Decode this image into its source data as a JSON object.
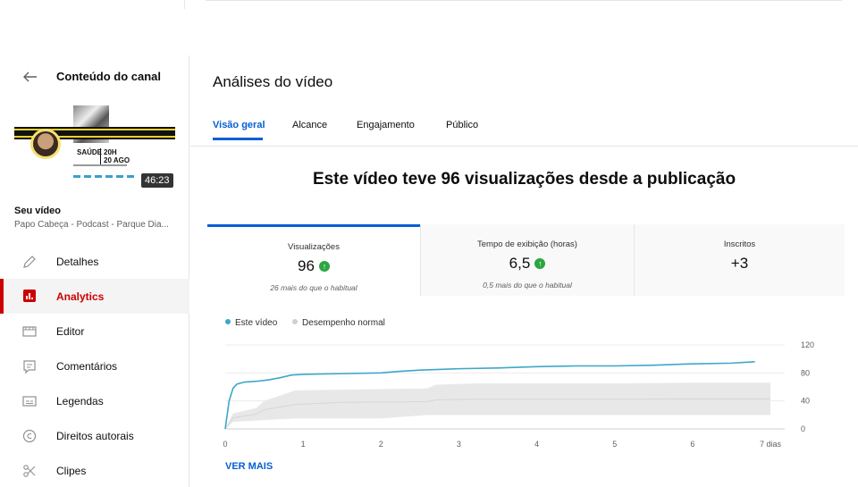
{
  "sidebar": {
    "title": "Conteúdo do canal",
    "video": {
      "duration": "46:23",
      "section_label": "Seu vídeo",
      "name": "Papo Cabeça - Podcast - Parque Dia...",
      "thumbnail_text": "SAÚDE",
      "thumbnail_time": "20H",
      "thumbnail_date": "20 AGO"
    },
    "items": [
      {
        "label": "Detalhes",
        "icon": "pencil-icon"
      },
      {
        "label": "Analytics",
        "icon": "analytics-icon",
        "active": true
      },
      {
        "label": "Editor",
        "icon": "film-editor-icon"
      },
      {
        "label": "Comentários",
        "icon": "comment-icon"
      },
      {
        "label": "Legendas",
        "icon": "subtitles-icon"
      },
      {
        "label": "Direitos autorais",
        "icon": "copyright-icon"
      },
      {
        "label": "Clipes",
        "icon": "scissors-icon"
      }
    ]
  },
  "main": {
    "title": "Análises do vídeo",
    "tabs": [
      {
        "label": "Visão geral",
        "active": true
      },
      {
        "label": "Alcance"
      },
      {
        "label": "Engajamento"
      },
      {
        "label": "Público"
      }
    ],
    "headline": "Este vídeo teve 96 visualizações desde a publicação",
    "metrics": [
      {
        "title": "Visualizações",
        "value": "96",
        "trend": "up",
        "note": "26 mais do que o habitual",
        "active": true
      },
      {
        "title": "Tempo de exibição (horas)",
        "value": "6,5",
        "trend": "up",
        "note": "0,5 mais do que o habitual"
      },
      {
        "title": "Inscritos",
        "value": "+3"
      }
    ],
    "legend": {
      "this_video": "Este vídeo",
      "normal": "Desempenho normal"
    },
    "more_link": "VER MAIS"
  },
  "colors": {
    "accent": "#065fd4",
    "active_nav": "#cc0000",
    "line": "#3ea6c9",
    "band": "#e6e6e6",
    "trend_up": "#2ba640"
  },
  "chart_data": {
    "type": "line",
    "x_ticks": [
      "0",
      "1",
      "2",
      "3",
      "4",
      "5",
      "6",
      "7 dias"
    ],
    "y_ticks": [
      "0",
      "40",
      "80",
      "120"
    ],
    "ylim": [
      0,
      120
    ],
    "xlim": [
      0,
      7
    ],
    "series": [
      {
        "name": "Este vídeo",
        "points": [
          [
            0,
            0
          ],
          [
            0.05,
            40
          ],
          [
            0.1,
            58
          ],
          [
            0.15,
            64
          ],
          [
            0.25,
            67
          ],
          [
            0.4,
            68
          ],
          [
            0.55,
            70
          ],
          [
            0.7,
            73
          ],
          [
            0.85,
            77
          ],
          [
            1.0,
            78
          ],
          [
            1.5,
            79
          ],
          [
            2.0,
            80
          ],
          [
            2.2,
            82
          ],
          [
            2.5,
            84
          ],
          [
            3.0,
            86
          ],
          [
            3.5,
            87
          ],
          [
            4.0,
            89
          ],
          [
            4.5,
            90
          ],
          [
            5.0,
            90
          ],
          [
            5.5,
            91
          ],
          [
            6.0,
            93
          ],
          [
            6.5,
            94
          ],
          [
            6.8,
            96
          ]
        ]
      }
    ],
    "band": {
      "name": "Desempenho normal",
      "lower": [
        [
          0,
          0
        ],
        [
          0.1,
          10
        ],
        [
          0.4,
          12
        ],
        [
          0.9,
          15
        ],
        [
          2.0,
          15
        ],
        [
          2.6,
          20
        ],
        [
          3.2,
          20
        ],
        [
          4.0,
          20
        ],
        [
          5.0,
          20
        ],
        [
          6.0,
          20
        ],
        [
          7.0,
          20
        ]
      ],
      "upper": [
        [
          0,
          0
        ],
        [
          0.1,
          22
        ],
        [
          0.4,
          30
        ],
        [
          0.5,
          40
        ],
        [
          0.9,
          55
        ],
        [
          1.5,
          56
        ],
        [
          2.6,
          58
        ],
        [
          2.7,
          63
        ],
        [
          3.2,
          65
        ],
        [
          4.0,
          65
        ],
        [
          5.0,
          65
        ],
        [
          6.0,
          66
        ],
        [
          7.0,
          66
        ]
      ]
    }
  }
}
